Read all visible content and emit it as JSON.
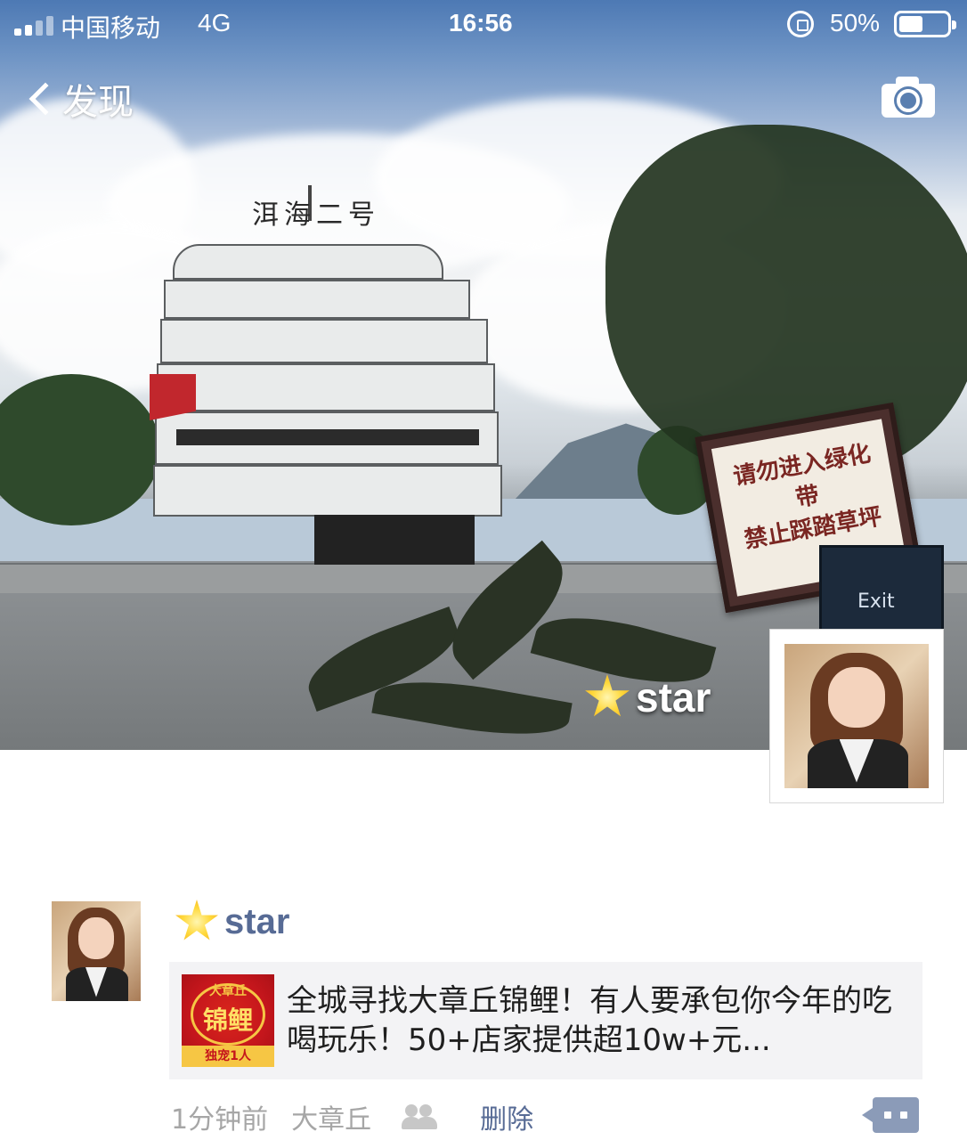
{
  "status_bar": {
    "carrier": "中国移动",
    "network": "4G",
    "time": "16:56",
    "battery_percent_label": "50%",
    "battery_level": 0.5
  },
  "nav": {
    "back_label": "发现",
    "camera_icon": "camera-icon"
  },
  "cover": {
    "user_name": "star",
    "name_emoji": "star-icon",
    "photo_signs": {
      "ship_name": "洱海二号",
      "warning_sign": [
        "请勿进入绿化带",
        "禁止踩踏草坪"
      ],
      "exit_sign": "Exit"
    }
  },
  "post": {
    "user_name": "star",
    "link_card": {
      "thumbnail": {
        "top_text": "大章丘",
        "main_text": "锦鲤",
        "footer_text": "独宠1人"
      },
      "title": "全城寻找大章丘锦鲤！有人要承包你今年的吃喝玩乐！50+店家提供超10w+元..."
    },
    "meta": {
      "time": "1分钟前",
      "location": "大章丘",
      "delete_label": "删除"
    }
  },
  "colors": {
    "link_blue": "#576b95",
    "meta_gray": "#a6a6a6",
    "card_bg": "#f3f3f5",
    "comment_button": "#8b9bb8"
  }
}
